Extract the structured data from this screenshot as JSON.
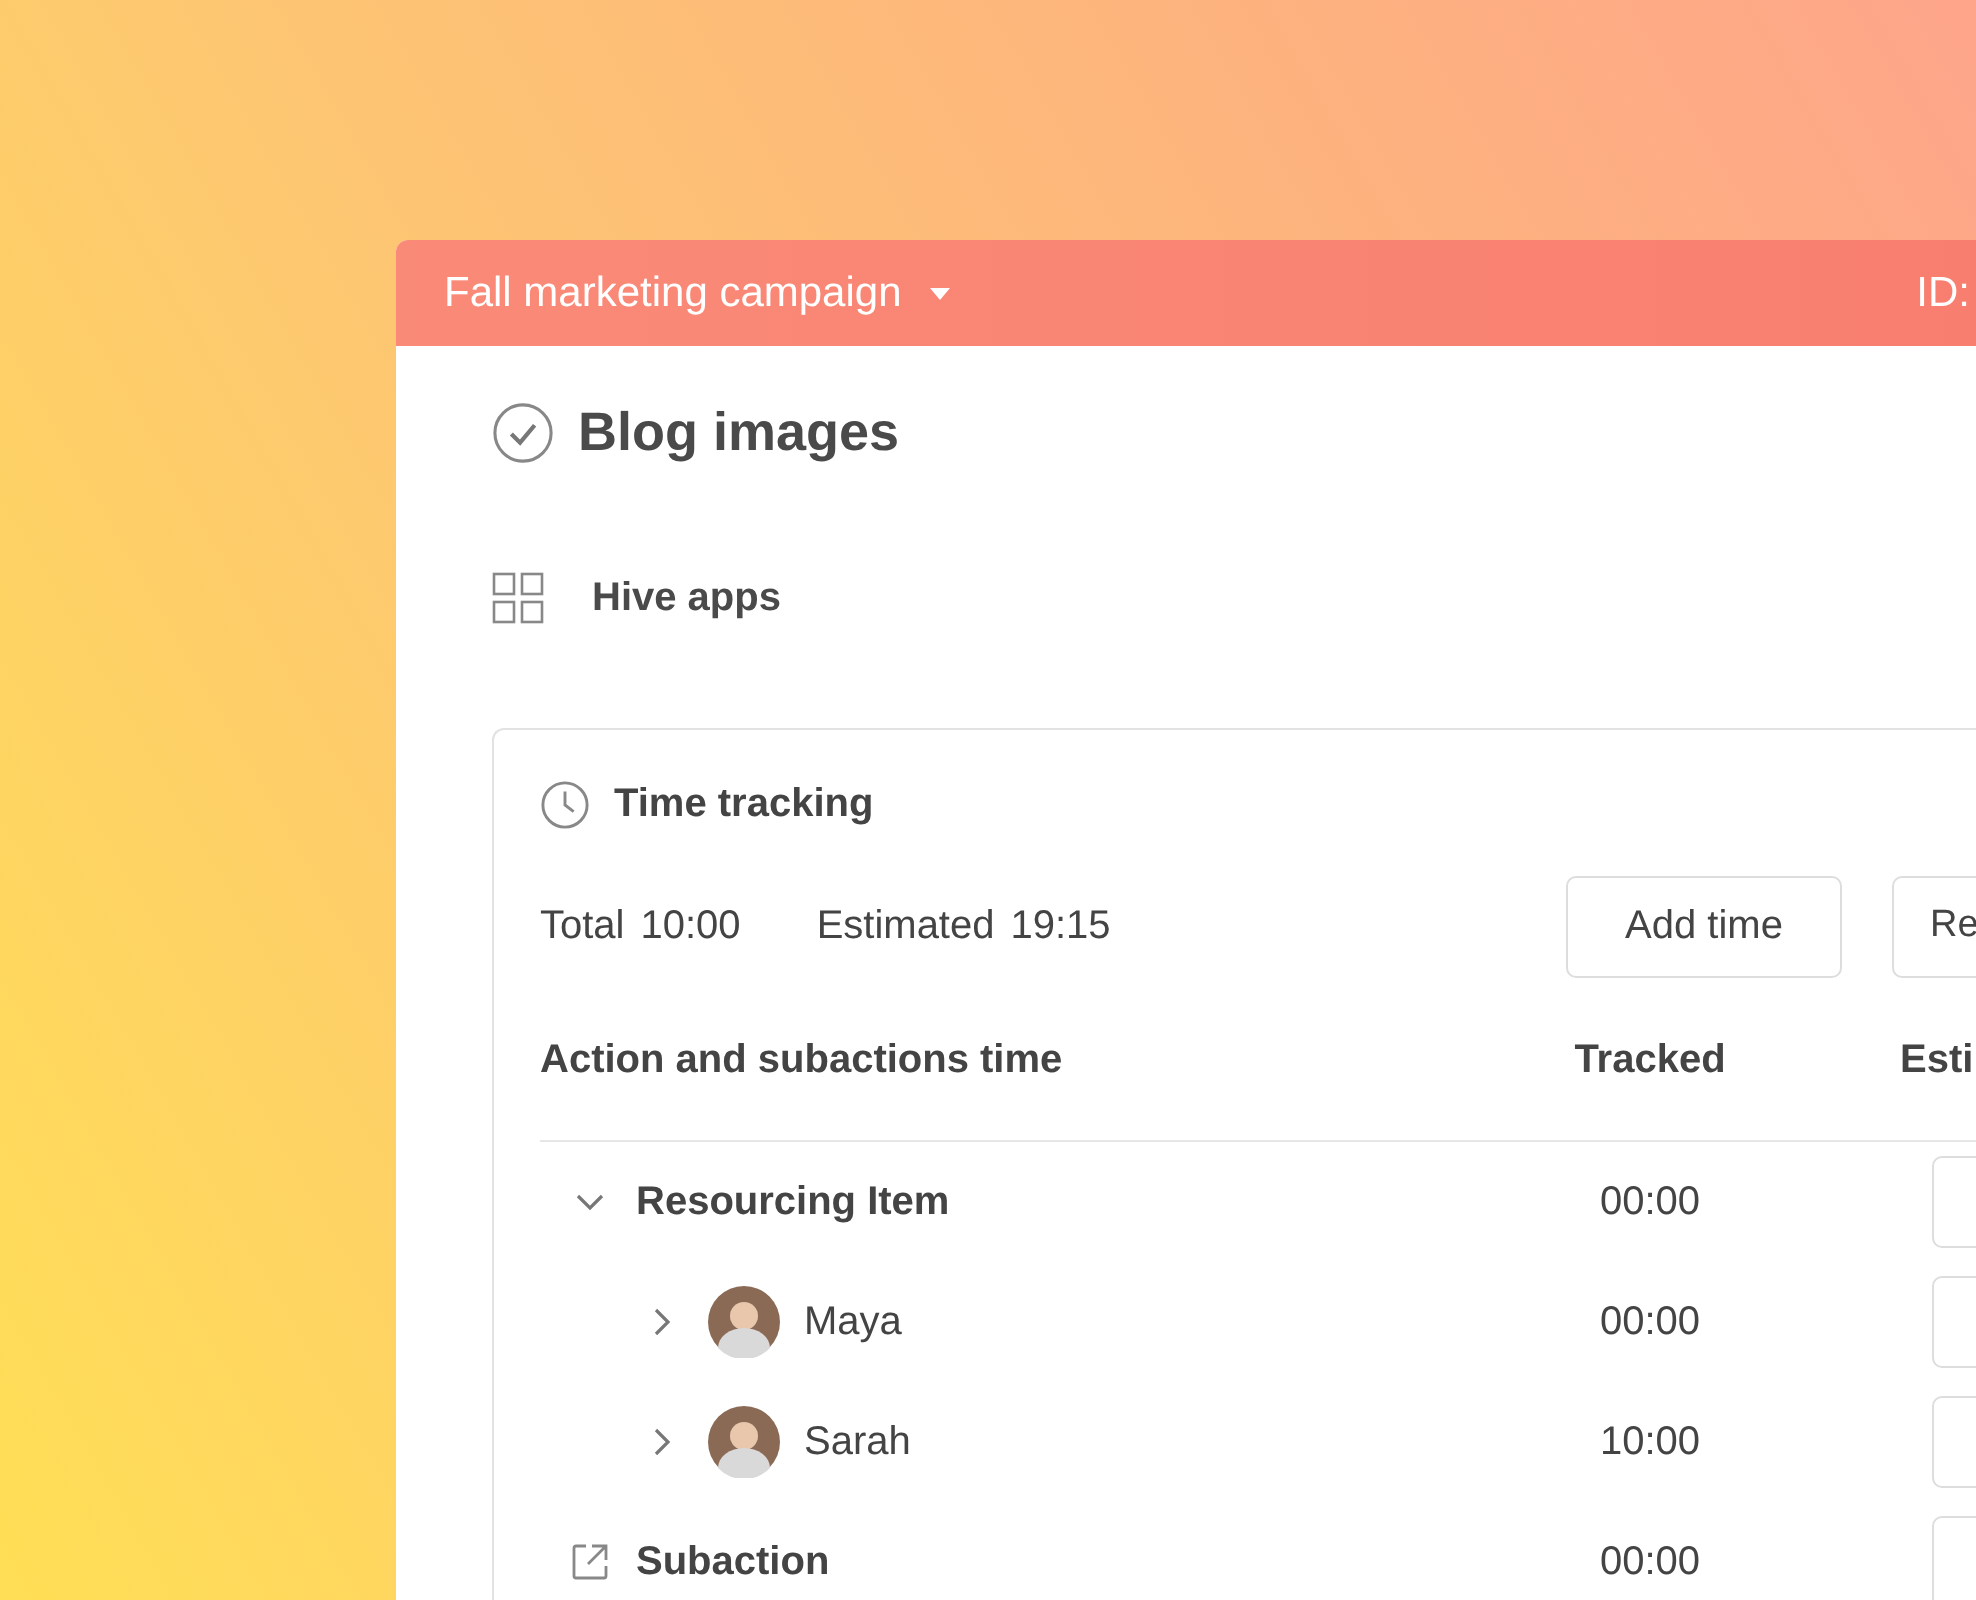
{
  "header": {
    "project": "Fall marketing campaign",
    "id_label": "ID:"
  },
  "task": {
    "title": "Blog images",
    "completed": false
  },
  "apps": {
    "label": "Hive apps"
  },
  "time_tracking": {
    "title": "Time tracking",
    "total_label": "Total",
    "total": "10:00",
    "estimated_label": "Estimated",
    "estimated": "19:15",
    "buttons": [
      "Add time",
      "Re"
    ],
    "columns": [
      "Action and subactions time",
      "Tracked",
      "Esti"
    ],
    "rows": [
      {
        "kind": "group",
        "name": "Resourcing Item",
        "tracked": "00:00",
        "expanded": true,
        "children": [
          {
            "kind": "person",
            "name": "Maya",
            "tracked": "00:00",
            "expanded": false
          },
          {
            "kind": "person",
            "name": "Sarah",
            "tracked": "10:00",
            "expanded": false
          }
        ]
      },
      {
        "kind": "subaction",
        "name": "Subaction",
        "tracked": "00:00"
      }
    ]
  }
}
